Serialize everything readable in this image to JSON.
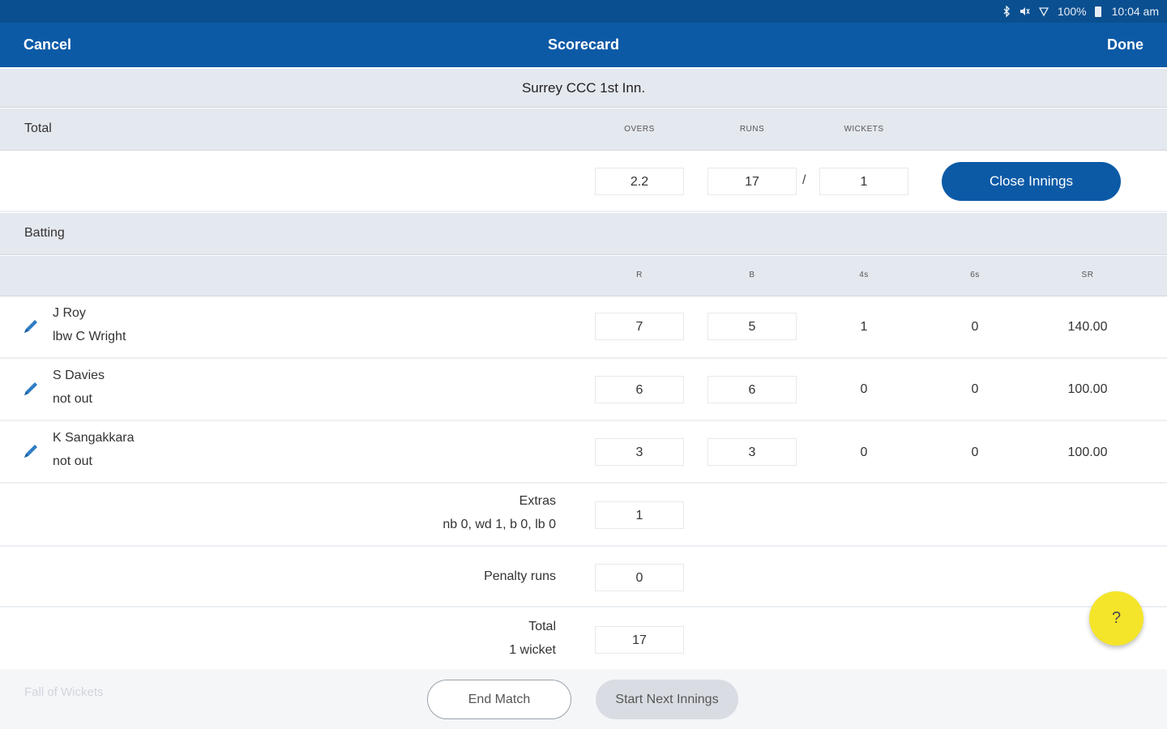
{
  "status_bar": {
    "icons": [
      "bluetooth-icon",
      "mute-icon",
      "wifi-icon",
      "battery-icon"
    ],
    "battery": "100%",
    "time": "10:04 am"
  },
  "app_bar": {
    "cancel": "Cancel",
    "title": "Scorecard",
    "done": "Done"
  },
  "innings_title": "Surrey CCC 1st Inn.",
  "total_section": {
    "label": "Total",
    "headers": {
      "overs": "OVERS",
      "runs": "RUNS",
      "wickets": "WICKETS"
    },
    "overs": "2.2",
    "runs": "17",
    "separator": "/",
    "wickets": "1",
    "close_button": "Close Innings"
  },
  "batting": {
    "label": "Batting",
    "headers": {
      "r": "R",
      "b": "B",
      "fours": "4s",
      "sixes": "6s",
      "sr": "SR"
    },
    "batsmen": [
      {
        "name": "J Roy",
        "dismissal": "lbw C Wright",
        "r": "7",
        "b": "5",
        "fours": "1",
        "sixes": "0",
        "sr": "140.00"
      },
      {
        "name": "S Davies",
        "dismissal": "not out",
        "r": "6",
        "b": "6",
        "fours": "0",
        "sixes": "0",
        "sr": "100.00"
      },
      {
        "name": "K Sangakkara",
        "dismissal": "not out",
        "r": "3",
        "b": "3",
        "fours": "0",
        "sixes": "0",
        "sr": "100.00"
      }
    ],
    "extras": {
      "label": "Extras",
      "detail": "nb 0, wd 1, b 0, lb 0",
      "value": "1"
    },
    "penalty": {
      "label": "Penalty runs",
      "value": "0"
    },
    "total": {
      "label": "Total",
      "detail": "1 wicket",
      "value": "17"
    }
  },
  "fall_of_wickets_label": "Fall of Wickets",
  "help_button": "?",
  "buttons": {
    "end_match": "End Match",
    "next_innings": "Start Next Innings"
  },
  "colors": {
    "primary": "#0c5aa6",
    "status_bar": "#0a4f8f",
    "band": "#e4e8ef",
    "fab": "#f4e52a"
  }
}
